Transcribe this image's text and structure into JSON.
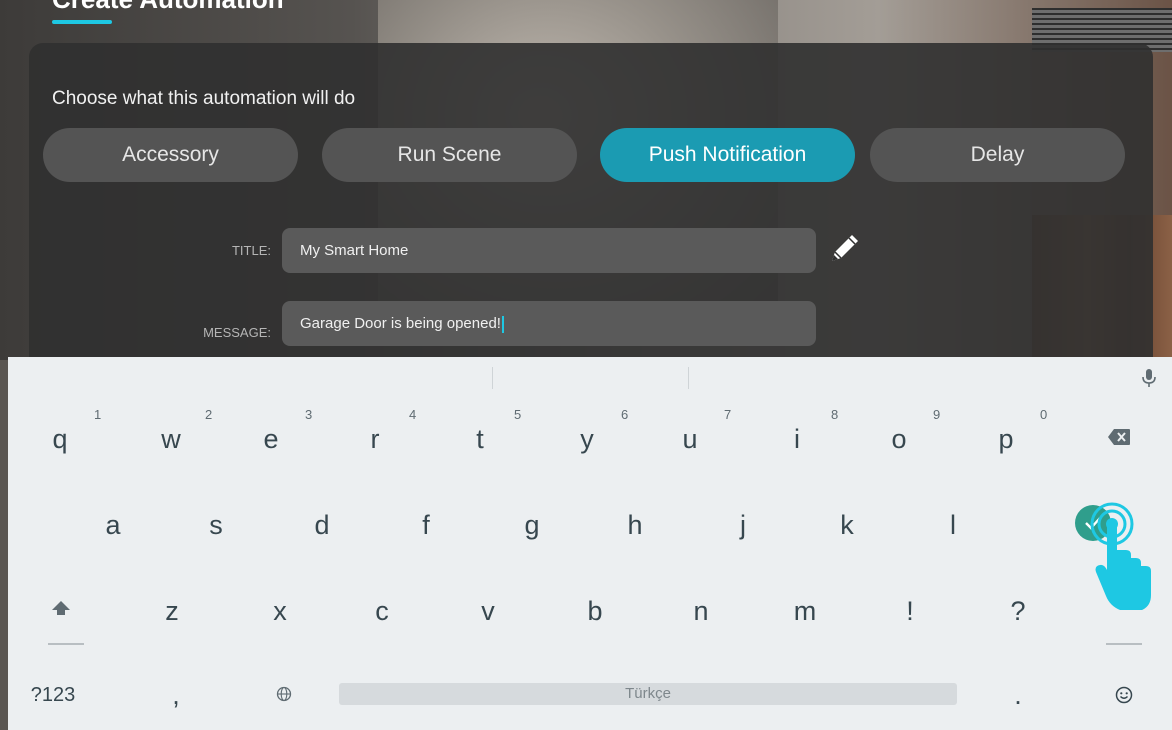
{
  "header": {
    "title": "Create Automation"
  },
  "panel": {
    "heading": "Choose what this automation will do",
    "tabs": [
      {
        "label": "Accessory",
        "active": false
      },
      {
        "label": "Run Scene",
        "active": false
      },
      {
        "label": "Push Notification",
        "active": true
      },
      {
        "label": "Delay",
        "active": false
      }
    ],
    "title_label": "TITLE:",
    "title_value": "My Smart Home",
    "message_label": "MESSAGE:",
    "message_value": "Garage Door is being opened!"
  },
  "keyboard": {
    "row1": [
      {
        "key": "q",
        "hint": "1"
      },
      {
        "key": "w",
        "hint": "2"
      },
      {
        "key": "e",
        "hint": "3"
      },
      {
        "key": "r",
        "hint": "4"
      },
      {
        "key": "t",
        "hint": "5"
      },
      {
        "key": "y",
        "hint": "6"
      },
      {
        "key": "u",
        "hint": "7"
      },
      {
        "key": "i",
        "hint": "8"
      },
      {
        "key": "o",
        "hint": "9"
      },
      {
        "key": "p",
        "hint": "0"
      }
    ],
    "row2": [
      "a",
      "s",
      "d",
      "f",
      "g",
      "h",
      "j",
      "k",
      "l"
    ],
    "row3": [
      "z",
      "x",
      "c",
      "v",
      "b",
      "n",
      "m",
      "!",
      "?"
    ],
    "symbols_label": "?123",
    "comma": ",",
    "space_label": "Türkçe",
    "period": "."
  },
  "colors": {
    "accent": "#1ec8e3",
    "active_tab": "#1b9bb2",
    "enter_key": "#2f9e8c",
    "tap_indicator": "#1ec8e3"
  }
}
